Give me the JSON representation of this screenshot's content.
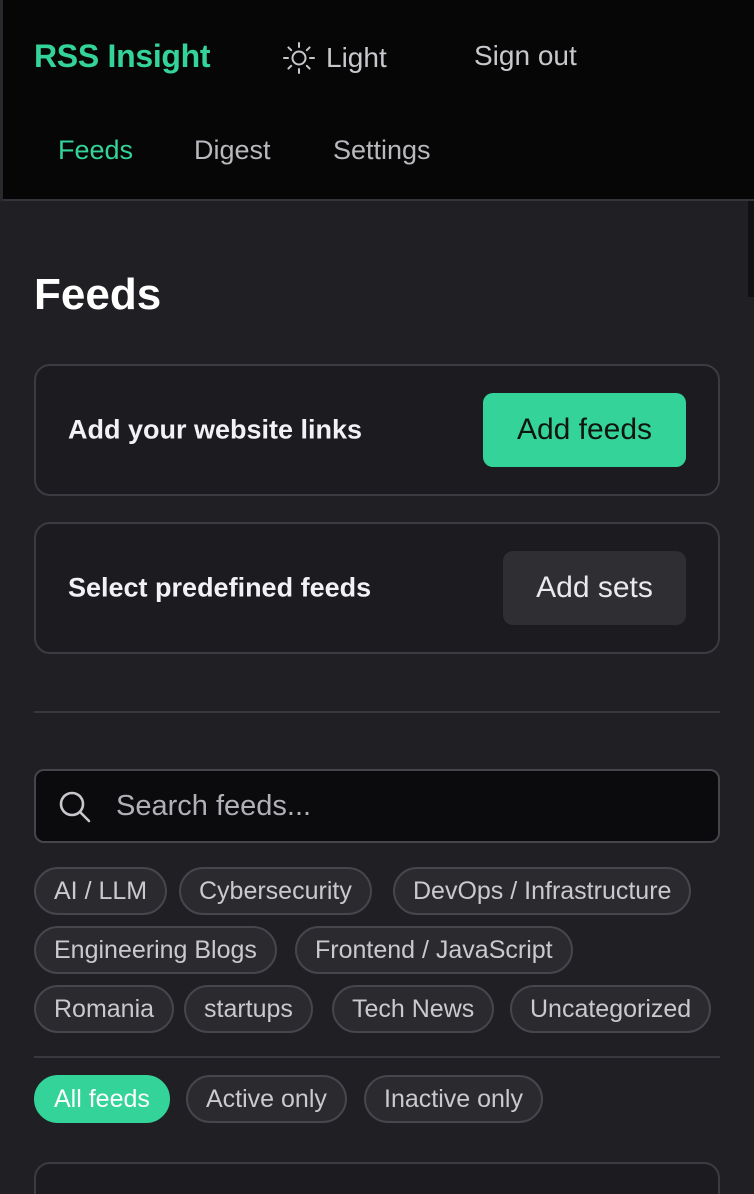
{
  "header": {
    "brand": "RSS Insight",
    "theme_label": "Light",
    "signout_label": "Sign out",
    "accent_color": "#34d399"
  },
  "nav": {
    "tabs": [
      {
        "label": "Feeds",
        "active": true
      },
      {
        "label": "Digest",
        "active": false
      },
      {
        "label": "Settings",
        "active": false
      }
    ]
  },
  "page": {
    "title": "Feeds"
  },
  "cards": {
    "add_links_text": "Add your website links",
    "add_feeds_button": "Add feeds",
    "predefined_text": "Select predefined feeds",
    "add_sets_button": "Add sets"
  },
  "search": {
    "placeholder": "Search feeds...",
    "value": ""
  },
  "categories": [
    "AI / LLM",
    "Cybersecurity",
    "DevOps / Infrastructure",
    "Engineering Blogs",
    "Frontend / JavaScript",
    "Romania",
    "startups",
    "Tech News",
    "Uncategorized"
  ],
  "filters": {
    "options": [
      "All feeds",
      "Active only",
      "Inactive only"
    ],
    "selected": "All feeds"
  },
  "icons": {
    "theme": "sun-icon",
    "search": "search-icon"
  }
}
